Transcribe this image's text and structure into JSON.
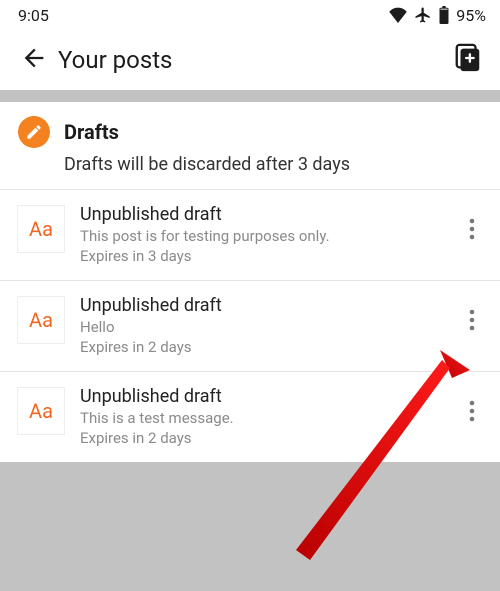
{
  "status": {
    "time": "9:05",
    "battery": "95%"
  },
  "header": {
    "title": "Your posts"
  },
  "section": {
    "title": "Drafts",
    "subtitle": "Drafts will be discarded after 3 days",
    "thumb_glyph": "Aa"
  },
  "drafts": [
    {
      "title": "Unpublished draft",
      "snippet": "This post is for testing purposes only.",
      "expires": "Expires in 3 days"
    },
    {
      "title": "Unpublished draft",
      "snippet": "Hello",
      "expires": "Expires in 2 days"
    },
    {
      "title": "Unpublished draft",
      "snippet": "This is a test message.",
      "expires": "Expires in 2 days"
    }
  ],
  "colors": {
    "accent": "#f58220"
  }
}
